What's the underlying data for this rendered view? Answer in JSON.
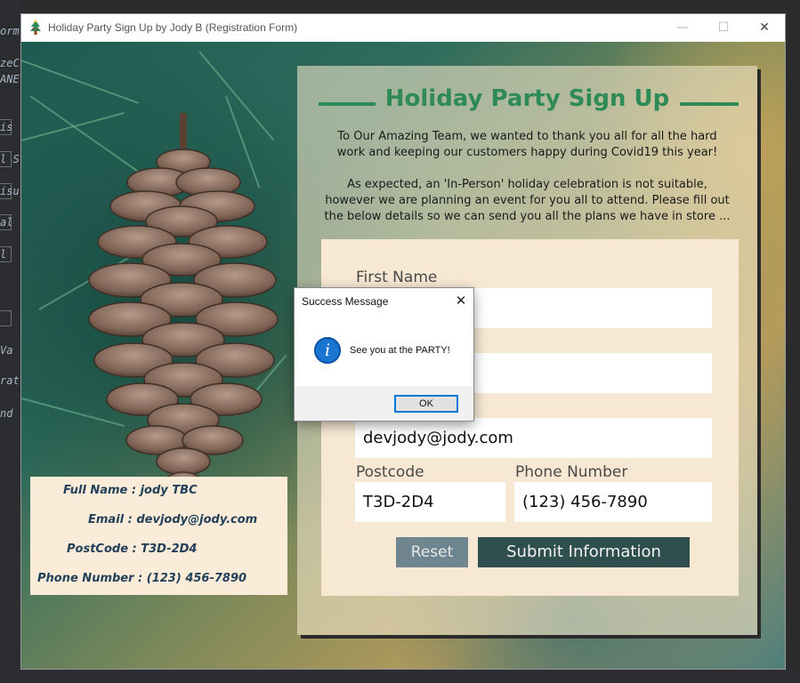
{
  "ide": {
    "fragments": [
      "orm",
      "zeC",
      "ANE",
      "is",
      "l S",
      "isu",
      "al",
      "l",
      "Va",
      "rat",
      "nd"
    ]
  },
  "window": {
    "title": "Holiday Party Sign Up by Jody B (Registration Form)",
    "icon": "christmas-tree-icon",
    "controls": {
      "minimize": "—",
      "maximize": "☐",
      "close": "✕"
    }
  },
  "card": {
    "heading": "Holiday Party Sign Up",
    "intro_paragraph_1": [
      "To Our Amazing Team, we wanted to thank you all for all the hard",
      "work and keeping our customers happy during Covid19 this year!"
    ],
    "intro_paragraph_2": [
      "As expected, an 'In-Person' holiday celebration is not suitable,",
      "however we are planning an event for you all to attend. Please fill out",
      "the below details so we can send you all the plans we have in store ..."
    ]
  },
  "form": {
    "first_name_label": "First Name",
    "first_name_value": "",
    "last_name_value": "",
    "email_value": "devjody@jody.com",
    "postcode_label": "Postcode",
    "postcode_value": "T3D-2D4",
    "phone_label": "Phone Number",
    "phone_value": "(123) 456-7890",
    "reset_label": "Reset",
    "submit_label": "Submit Information"
  },
  "summary": {
    "full_name": "Full Name : jody TBC",
    "email": "Email : devjody@jody.com",
    "postcode": "PostCode : T3D-2D4",
    "phone": "Phone Number : (123) 456-7890"
  },
  "dialog": {
    "title": "Success Message",
    "close": "✕",
    "icon": "info-icon",
    "icon_glyph": "i",
    "message": "See you at the PARTY!",
    "ok_label": "OK"
  },
  "colors": {
    "accent_green": "#2e8b57",
    "submit_bg": "#2f4f4f",
    "reset_bg": "#6f8690",
    "summary_text": "#23405a"
  }
}
